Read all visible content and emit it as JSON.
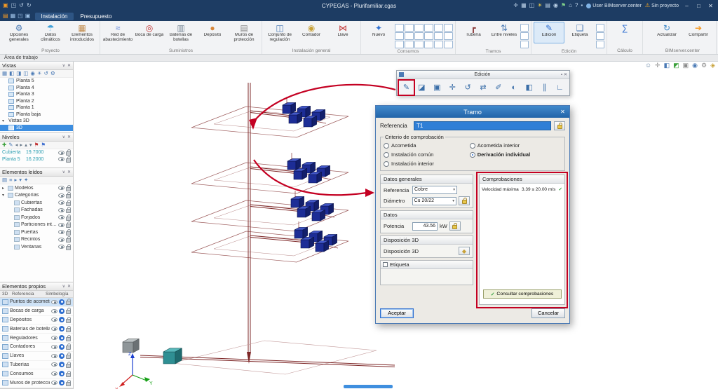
{
  "titlebar": {
    "title": "CYPEGAS - Plurifamiliar.cgas",
    "user": "User BIMserver.center",
    "project_status": "Sin proyecto",
    "left_icons": [
      {
        "name": "app-icon",
        "glyph": "▣",
        "color": "#f59a23"
      },
      {
        "name": "save-icon",
        "glyph": "◳",
        "color": "#bcd2e8"
      },
      {
        "name": "undo-icon",
        "glyph": "↺",
        "color": "#bcd2e8"
      },
      {
        "name": "redo-icon",
        "glyph": "↻",
        "color": "#bcd2e8"
      }
    ],
    "right_icons": [
      {
        "name": "snap-icon",
        "glyph": "✛",
        "color": "#bcd2e8"
      },
      {
        "name": "grid-icon",
        "glyph": "▦",
        "color": "#bcd2e8"
      },
      {
        "name": "views-icon",
        "glyph": "◫",
        "color": "#bcd2e8"
      },
      {
        "name": "sun-icon",
        "glyph": "☀",
        "color": "#e8c84a"
      },
      {
        "name": "layers-icon",
        "glyph": "▤",
        "color": "#bcd2e8"
      },
      {
        "name": "camera-icon",
        "glyph": "◉",
        "color": "#bcd2e8"
      },
      {
        "name": "flag-icon",
        "glyph": "⚑",
        "color": "#7fd08a"
      },
      {
        "name": "home-icon",
        "glyph": "⌂",
        "color": "#bcd2e8"
      },
      {
        "name": "help-icon",
        "glyph": "?",
        "color": "#bcd2e8"
      },
      {
        "name": "pin-icon",
        "glyph": "▪",
        "color": "#bcd2e8"
      }
    ],
    "window_controls": [
      {
        "name": "minimize-button",
        "glyph": "–"
      },
      {
        "name": "maximize-button",
        "glyph": "□"
      },
      {
        "name": "close-button",
        "glyph": "✕"
      }
    ]
  },
  "menubar": {
    "icons": [
      {
        "name": "new-icon",
        "glyph": "▤",
        "color": "#f59a23"
      },
      {
        "name": "open-icon",
        "glyph": "▦",
        "color": "#9fc3e8"
      },
      {
        "name": "save-icon",
        "glyph": "◳",
        "color": "#9fc3e8"
      },
      {
        "name": "print-icon",
        "glyph": "▣",
        "color": "#9fc3e8"
      }
    ],
    "tabs": [
      {
        "label": "Instalación",
        "active": true
      },
      {
        "label": "Presupuesto",
        "active": false
      }
    ]
  },
  "ribbon": {
    "groups": [
      {
        "label": "Proyecto",
        "items": [
          {
            "icon": "gear-icon",
            "glyph": "⚙",
            "color": "#4a7ab5",
            "label": "Opciones generales"
          },
          {
            "icon": "climate-icon",
            "glyph": "☂",
            "color": "#3fa0d8",
            "label": "Datos climáticos"
          },
          {
            "icon": "elements-icon",
            "glyph": "▦",
            "color": "#c08a4a",
            "label": "Elementos introducidos"
          }
        ]
      },
      {
        "label": "Suministros",
        "items": [
          {
            "icon": "supply-network-icon",
            "glyph": "≈",
            "color": "#3f6fd8",
            "label": "Red de abastecimiento"
          },
          {
            "icon": "charge-point-icon",
            "glyph": "◎",
            "color": "#c03030",
            "label": "Boca de carga"
          },
          {
            "icon": "bottle-battery-icon",
            "glyph": "▥",
            "color": "#7a8a98",
            "label": "Baterías de botellas"
          },
          {
            "icon": "tank-icon",
            "glyph": "●",
            "color": "#d8873a",
            "label": "Depósito"
          },
          {
            "icon": "protection-wall-icon",
            "glyph": "▤",
            "color": "#8a8a8a",
            "label": "Muros de protección"
          }
        ]
      },
      {
        "label": "Instalación general",
        "items": [
          {
            "icon": "regulator-icon",
            "glyph": "◫",
            "color": "#4a7ab5",
            "label": "Conjunto de regulación"
          },
          {
            "icon": "meter-icon",
            "glyph": "◉",
            "color": "#c8a23a",
            "label": "Contador"
          },
          {
            "icon": "valve-icon",
            "glyph": "⋈",
            "color": "#c03030",
            "label": "Llave"
          }
        ]
      },
      {
        "label": "Consumos",
        "items": [
          {
            "icon": "new-consumption-icon",
            "glyph": "✦",
            "color": "#2f6fd0",
            "label": "Nuevo"
          }
        ]
      },
      {
        "label": "Tramos",
        "items": [
          {
            "icon": "pipe-icon",
            "glyph": "┏",
            "color": "#8a3a3a",
            "label": "Tubería"
          },
          {
            "icon": "between-levels-icon",
            "glyph": "⇅",
            "color": "#4a7ab5",
            "label": "Entre niveles"
          }
        ]
      },
      {
        "label": "Edición",
        "items": [
          {
            "icon": "edit-icon",
            "glyph": "✎",
            "color": "#2f6fd0",
            "label": "Edición",
            "active": true
          },
          {
            "icon": "label-icon",
            "glyph": "❑",
            "color": "#4a7ab5",
            "label": "Etiqueta"
          }
        ]
      },
      {
        "label": "Cálculo",
        "items": [
          {
            "icon": "calculate-icon",
            "glyph": "∑",
            "color": "#2f6fd0",
            "label": ""
          }
        ]
      },
      {
        "label": "BIMserver.center",
        "items": [
          {
            "icon": "update-icon",
            "glyph": "↻",
            "color": "#3a86c8",
            "label": "Actualizar"
          },
          {
            "icon": "share-icon",
            "glyph": "➔",
            "color": "#f59a23",
            "label": "Compartir"
          }
        ]
      }
    ]
  },
  "workspace": {
    "label": "Área de trabajo"
  },
  "canvas_icons": [
    {
      "name": "user-icon",
      "glyph": "☺",
      "color": "#6a88a8"
    },
    {
      "name": "measure-icon",
      "glyph": "✛",
      "color": "#8a8a8a"
    },
    {
      "name": "cube-icon",
      "glyph": "◧",
      "color": "#4a7ab5"
    },
    {
      "name": "green-layer-icon",
      "glyph": "◩",
      "color": "#3aa03a"
    },
    {
      "name": "monitor-icon",
      "glyph": "▣",
      "color": "#8a8a8a"
    },
    {
      "name": "visibility-icon",
      "glyph": "◉",
      "color": "#4a7ab5"
    },
    {
      "name": "tools-icon",
      "glyph": "⚙",
      "color": "#8a8a8a"
    },
    {
      "name": "info-icon",
      "glyph": "◈",
      "color": "#c8a23a"
    }
  ],
  "panels": {
    "vistas": {
      "title": "Vistas",
      "tools": [
        {
          "name": "floor-plan-icon",
          "glyph": "▦"
        },
        {
          "name": "3d-view-icon",
          "glyph": "◧"
        },
        {
          "name": "section-icon",
          "glyph": "◨"
        },
        {
          "name": "elevation-icon",
          "glyph": "◫"
        },
        {
          "name": "camera-icon",
          "glyph": "◉"
        },
        {
          "name": "sun-icon",
          "glyph": "☀"
        },
        {
          "name": "rotate-icon",
          "glyph": "↺"
        },
        {
          "name": "settings-icon",
          "glyph": "⚙"
        }
      ],
      "items": [
        "Planta 5",
        "Planta 4",
        "Planta 3",
        "Planta 2",
        "Planta 1",
        "Planta baja"
      ],
      "group_chevron": "▾",
      "group_label": "Vistas 3D",
      "selected_item": "3D"
    },
    "niveles": {
      "title": "Niveles",
      "tools": [
        {
          "name": "add-icon",
          "glyph": "✚",
          "color": "#3aa03a"
        },
        {
          "name": "edit-icon",
          "glyph": "✎",
          "color": "#4a7ab5"
        },
        {
          "name": "prev-icon",
          "glyph": "◂",
          "color": "#667788"
        },
        {
          "name": "next-icon",
          "glyph": "▸",
          "color": "#667788"
        },
        {
          "name": "up-icon",
          "glyph": "▴",
          "color": "#667788"
        },
        {
          "name": "down-icon",
          "glyph": "▾",
          "color": "#667788"
        },
        {
          "name": "flag-red-icon",
          "glyph": "⚑",
          "color": "#c03030"
        },
        {
          "name": "flag-blue-icon",
          "glyph": "⚑",
          "color": "#3f6fd0"
        }
      ],
      "rows": [
        {
          "name": "Cubierta",
          "value": "19.7000"
        },
        {
          "name": "Planta 5",
          "value": "16.2000"
        }
      ]
    },
    "elementos_leidos": {
      "title": "Elementos leídos",
      "tools": [
        {
          "name": "models-icon",
          "glyph": "▤"
        },
        {
          "name": "tree-icon",
          "glyph": "≡"
        },
        {
          "name": "expand-icon",
          "glyph": "▸"
        },
        {
          "name": "collapse-icon",
          "glyph": "▾"
        },
        {
          "name": "highlight-icon",
          "glyph": "✦"
        }
      ],
      "tree": [
        {
          "label": "Modelos",
          "chevron": "▸",
          "child": false
        },
        {
          "label": "Categorías",
          "chevron": "▾",
          "child": false
        },
        {
          "label": "Cubiertas",
          "chevron": "",
          "child": true
        },
        {
          "label": "Fachadas",
          "chevron": "",
          "child": true
        },
        {
          "label": "Forjados",
          "chevron": "",
          "child": true
        },
        {
          "label": "Particiones interiores",
          "chevron": "",
          "child": true
        },
        {
          "label": "Puertas",
          "chevron": "",
          "child": true
        },
        {
          "label": "Recintos",
          "chevron": "",
          "child": true
        },
        {
          "label": "Ventanas",
          "chevron": "",
          "child": true
        }
      ]
    },
    "elementos_propios": {
      "title": "Elementos propios",
      "columns": [
        "3D",
        "Referencia",
        "Simbología"
      ],
      "rows": [
        {
          "label": "Puntos de acometida",
          "selected": true
        },
        {
          "label": "Bocas de carga"
        },
        {
          "label": "Depósitos"
        },
        {
          "label": "Baterías de botellas"
        },
        {
          "label": "Reguladores"
        },
        {
          "label": "Contadores"
        },
        {
          "label": "Llaves"
        },
        {
          "label": "Tuberías"
        },
        {
          "label": "Consumos"
        },
        {
          "label": "Muros de protección"
        }
      ]
    }
  },
  "edit_toolbar": {
    "title": "Edición",
    "icons": [
      {
        "name": "edit-icon",
        "glyph": "✎",
        "hl": true
      },
      {
        "name": "erase-icon",
        "glyph": "◪"
      },
      {
        "name": "copy-icon",
        "glyph": "▣"
      },
      {
        "name": "move-icon",
        "glyph": "✛"
      },
      {
        "name": "rotate-icon",
        "glyph": "↺"
      },
      {
        "name": "stretch-icon",
        "glyph": "⇄"
      },
      {
        "name": "assign-icon",
        "glyph": "✐"
      },
      {
        "name": "invert-icon",
        "glyph": "◐"
      },
      {
        "name": "mirror-icon",
        "glyph": "◧"
      },
      {
        "name": "offset-icon",
        "glyph": "∥"
      },
      {
        "name": "angle-icon",
        "glyph": "∟"
      }
    ]
  },
  "dialog": {
    "title": "Tramo",
    "referencia_label": "Referencia",
    "referencia_value": "T1",
    "criterio": {
      "legend": "Criterio de comprobación",
      "options": [
        {
          "label": "Acometida",
          "checked": false
        },
        {
          "label": "Instalación común",
          "checked": false
        },
        {
          "label": "Instalación interior",
          "checked": false
        },
        {
          "label": "Acometida interior",
          "checked": false
        },
        {
          "label": "Derivación individual",
          "checked": true
        }
      ]
    },
    "datos_generales": {
      "header": "Datos generales",
      "referencia_label": "Referencia",
      "referencia_value": "Cobre",
      "diametro_label": "Diámetro",
      "diametro_value": "Cu 20/22"
    },
    "datos": {
      "header": "Datos",
      "potencia_label": "Potencia",
      "potencia_value": "43.56",
      "potencia_unit": "kW"
    },
    "disposicion": {
      "header": "Disposición 3D",
      "label": "Disposición 3D"
    },
    "etiqueta": {
      "label": "Etiqueta"
    },
    "comprobaciones": {
      "header": "Comprobaciones",
      "check_name": "Velocidad máxima",
      "check_value": "3.39 ≤ 20.00 m/s",
      "consult_label": "Consultar comprobaciones"
    },
    "accept_label": "Aceptar",
    "cancel_label": "Cancelar"
  },
  "axis": {
    "x": "X",
    "y": "Y",
    "z": "Z"
  },
  "ui": {
    "collapse_glyph": "∨",
    "close_glyph": "✕",
    "select_chevron": "▾",
    "check_glyph": "✓",
    "pin_glyph": "▪",
    "disposicion_glyph": "◆"
  },
  "colors": {
    "accent": "#2a6cb5",
    "selection": "#3d8ee0",
    "annotation": "#c40022",
    "pipe": "#7e2828"
  }
}
